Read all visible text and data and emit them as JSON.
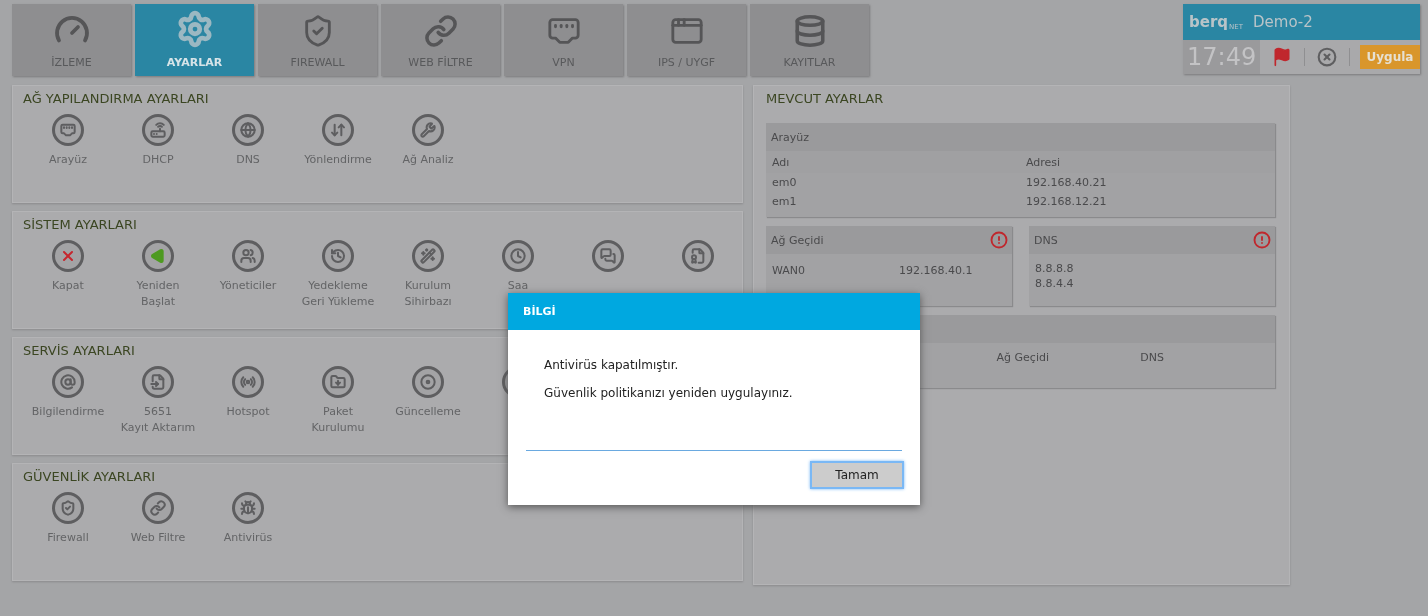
{
  "nav_tabs": [
    {
      "label": "İZLEME",
      "selected": false
    },
    {
      "label": "AYARLAR",
      "selected": true
    },
    {
      "label": "FIREWALL",
      "selected": false
    },
    {
      "label": "WEB FİLTRE",
      "selected": false
    },
    {
      "label": "VPN",
      "selected": false
    },
    {
      "label": "IPS / UYGF",
      "selected": false
    },
    {
      "label": "KAYITLAR",
      "selected": false
    }
  ],
  "device": {
    "logo": "berq",
    "logo_sub": "NET",
    "name": "Demo-2",
    "time": "17:49",
    "apply_button": "Uygula"
  },
  "sections": [
    {
      "title": "AĞ YAPILANDIRMA AYARLARI",
      "items": [
        {
          "kind": "labeled",
          "label": "Arayüz"
        },
        {
          "kind": "labeled",
          "label": "DHCP"
        },
        {
          "kind": "labeled",
          "label": "DNS"
        },
        {
          "kind": "labeled",
          "label": "Yönlendirme"
        },
        {
          "kind": "labeled",
          "label": "Ağ Analiz"
        }
      ]
    },
    {
      "title": "SİSTEM AYARLARI",
      "items": [
        {
          "kind": "labeled",
          "label": "Kapat"
        },
        {
          "kind": "labeled",
          "label": "Yeniden\nBaşlat"
        },
        {
          "kind": "labeled",
          "label": "Yöneticiler"
        },
        {
          "kind": "labeled",
          "label": "Yedekleme\nGeri Yükleme"
        },
        {
          "kind": "labeled",
          "label": "Kurulum\nSihirbazı"
        },
        {
          "kind": "labeled",
          "label": "Saa"
        },
        {
          "kind": "icon"
        },
        {
          "kind": "icon"
        }
      ]
    },
    {
      "title": "SERVİS AYARLARI",
      "items": [
        {
          "kind": "labeled",
          "label": "Bilgilendirme"
        },
        {
          "kind": "labeled",
          "label": "5651\nKayıt Aktarım"
        },
        {
          "kind": "labeled",
          "label": "Hotspot"
        },
        {
          "kind": "labeled",
          "label": "Paket\nKurulumu"
        },
        {
          "kind": "labeled",
          "label": "Güncelleme"
        },
        {
          "kind": "icon"
        }
      ]
    },
    {
      "title": "GÜVENLİK AYARLARI",
      "items": [
        {
          "kind": "labeled",
          "label": "Firewall"
        },
        {
          "kind": "labeled",
          "label": "Web Filtre"
        },
        {
          "kind": "labeled",
          "label": "Antivirüs"
        }
      ]
    }
  ],
  "current_settings": {
    "title": "MEVCUT AYARLAR",
    "interfaces": {
      "title": "Arayüz",
      "columns": [
        "Adı",
        "Adresi"
      ],
      "rows": [
        [
          "em0",
          "192.168.40.21"
        ],
        [
          "em1",
          "192.168.12.21"
        ]
      ]
    },
    "gateway": {
      "title": "Ağ Geçidi",
      "warning": true,
      "rows": [
        [
          "WAN0",
          "192.168.40.1"
        ]
      ]
    },
    "dns": {
      "title": "DNS",
      "warning": true,
      "rows": [
        "8.8.8.8",
        "8.8.4.4"
      ]
    },
    "third_box": {
      "columns": [
        "Ağ Geçidi",
        "DNS"
      ]
    }
  },
  "dialog": {
    "title": "BİLGİ",
    "lines": [
      "Antivirüs kapatılmıştır.",
      "Güvenlik politikanızı yeniden uygulayınız."
    ],
    "button": "Tamam"
  }
}
